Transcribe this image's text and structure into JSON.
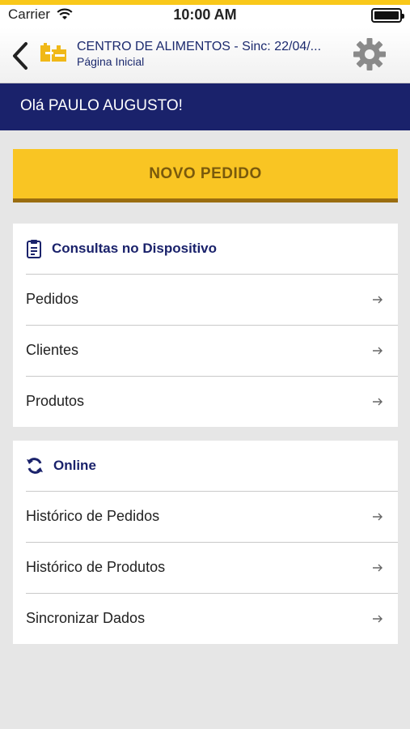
{
  "status_bar": {
    "carrier": "Carrier",
    "time": "10:00 AM",
    "icons": [
      "wifi-icon",
      "battery-icon"
    ]
  },
  "nav": {
    "title": "CENTRO DE ALIMENTOS - Sinc: 22/04/...",
    "subtitle": "Página Inicial",
    "icons": [
      "back-chevron-icon",
      "logo-icon",
      "gear-icon"
    ]
  },
  "greeting": "Olá PAULO AUGUSTO!",
  "primary_button": "NOVO PEDIDO",
  "sections": [
    {
      "title": "Consultas no Dispositivo",
      "icon": "clipboard-icon",
      "items": [
        "Pedidos",
        "Clientes",
        "Produtos"
      ]
    },
    {
      "title": "Online",
      "icon": "sync-icon",
      "items": [
        "Histórico de Pedidos",
        "Histórico de Produtos",
        "Sincronizar Dados"
      ]
    }
  ],
  "colors": {
    "accent_yellow": "#f9c523",
    "navy": "#1a226b",
    "background": "#e6e6e6"
  }
}
